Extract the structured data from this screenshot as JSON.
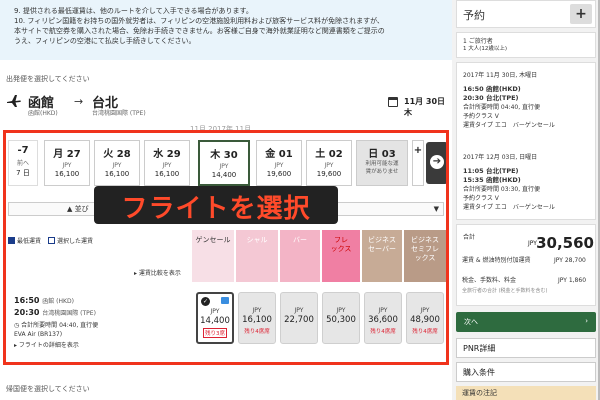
{
  "notice": {
    "lines": [
      "9. 提供される最低運賃は、他のルートを介して入手できる場合があります。",
      "10. フィリピン国籍をお持ちの国外就労者は、フィリピンの空港施設利用料および旅客サービス料が免除されますが、",
      "本サイトで航空券を購入された場合、免除お手続きできません。お客様ご自身で海外就業証明など関連書類をご提示の",
      "うえ、フィリピンの空港にて払戻し手続きしてください。"
    ]
  },
  "outbound_label": "出発便を選択してください",
  "route": {
    "from_city": "函館",
    "from_airport": "函館(HKD)",
    "to_city": "台北",
    "to_airport": "台湾桃園国際 (TPE)",
    "date": "11月 30日 木",
    "arrow": "→"
  },
  "partial_title": "11月  2017年 11月",
  "date_strip": {
    "prev": {
      "day": "-7",
      "line2": "前へ",
      "line3": "7 日"
    },
    "days": [
      {
        "day": "月 27",
        "currency": "JPY",
        "price": "16,100",
        "state": "normal"
      },
      {
        "day": "火 28",
        "currency": "JPY",
        "price": "16,100",
        "state": "normal"
      },
      {
        "day": "水 29",
        "currency": "JPY",
        "price": "16,100",
        "state": "normal"
      },
      {
        "day": "木 30",
        "currency": "JPY",
        "price": "14,400",
        "state": "selected"
      },
      {
        "day": "金 01",
        "currency": "JPY",
        "price": "19,600",
        "state": "normal"
      },
      {
        "day": "土 02",
        "currency": "JPY",
        "price": "19,600",
        "state": "normal"
      },
      {
        "day": "日 03",
        "currency": "利用可能な運",
        "price": "賃がありませ",
        "state": "na"
      }
    ],
    "next_partial": "+"
  },
  "overlay": "フライトを選択",
  "sort": {
    "label": "並び",
    "caret": "▼"
  },
  "legend": {
    "lowest": "最低運賃",
    "chosen": "選択した運賃"
  },
  "fare_types": [
    {
      "label": "ゲンセール",
      "color": "#f7dfe6",
      "text": "#333"
    },
    {
      "label": "シャル",
      "color": "#f4c8d4",
      "text": "#fff"
    },
    {
      "label": "バー",
      "color": "#f3b4c6",
      "text": "#fff"
    },
    {
      "label": "フレ\nックス",
      "color": "#f07fa3",
      "text": "#c00"
    },
    {
      "label": "ビジネス\nセーバー",
      "color": "#c7ab96",
      "text": "#fff"
    },
    {
      "label": "ビジネス\nセミフレ\nックス",
      "color": "#b99b87",
      "text": "#fff"
    }
  ],
  "compare_link": "運賃比較を表示",
  "flight": {
    "dep_time": "16:50",
    "dep_airport": "函館 (HKD)",
    "arr_time": "20:30",
    "arr_airport": "台湾桃園国際 (TPE)",
    "duration": "合計所要時間 04:40, 直行便",
    "airline": "EVA Air (BR137)",
    "details": "フライトの詳細を表示"
  },
  "fares": [
    {
      "currency": "JPY",
      "amount": "14,400",
      "left": "残り3席",
      "chosen": true
    },
    {
      "currency": "JPY",
      "amount": "16,100",
      "left": "残り4席席",
      "chosen": false
    },
    {
      "currency": "JPY",
      "amount": "22,700",
      "left": "",
      "chosen": false
    },
    {
      "currency": "JPY",
      "amount": "50,300",
      "left": "",
      "chosen": false
    },
    {
      "currency": "JPY",
      "amount": "36,600",
      "left": "残り4席席",
      "chosen": false
    },
    {
      "currency": "JPY",
      "amount": "48,900",
      "left": "残り4席席",
      "chosen": false
    }
  ],
  "return_label": "帰国便を選択してください",
  "side": {
    "title": "予約",
    "plus": "+",
    "itinerary": "1 ご旅行者",
    "passengers": "1 大人(12歳以上)",
    "seg1_date": "2017年 11月 30日, 木曜日",
    "seg1_dep": "16:50 函館(HKD)",
    "seg1_arr": "20:30 台北(TPE)",
    "seg1_dur": "合計所要時間 04:40, 直行便",
    "seg1_class": "予約クラス V",
    "seg1_type": "運賃タイプ エコ　バーゲンセール",
    "seg2_date": "2017年 12月 03日, 日曜日",
    "seg2_dep": "11:05 台北(TPE)",
    "seg2_arr": "15:35 函館(HKD)",
    "seg2_dur": "合計所要時間 03:30, 直行便",
    "seg2_class": "予約クラス V",
    "seg2_type": "運賃タイプ エコ　バーゲンセール",
    "total_label": "合計",
    "total_currency": "JPY",
    "total_amount": "30,560",
    "fare_line": "運賃 & 燃油特別付加運賃",
    "fare_line_amt": "JPY 28,700",
    "tax_line": "税金、手数料、料金",
    "tax_line_amt": "JPY 1,860",
    "note": "全旅行者の合計 (税金と手数料を含む)",
    "next_button": "次へ",
    "pnr_button": "PNR詳細",
    "terms_button": "購入条件",
    "bottom_note": "運賃の注記"
  }
}
